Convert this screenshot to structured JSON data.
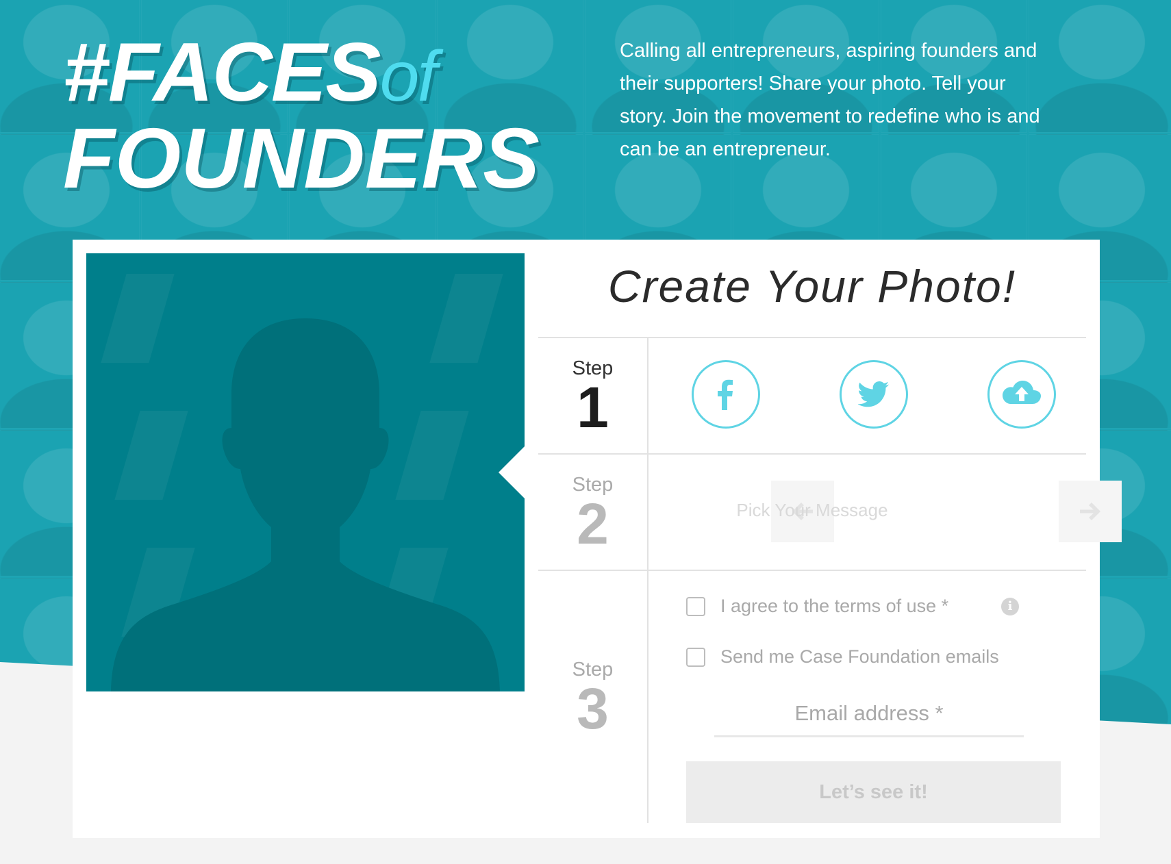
{
  "hero": {
    "title_hash": "#FACES",
    "title_of": "of",
    "title_line2": "FOUNDERS",
    "description": "Calling all entrepreneurs, aspiring founders and their supporters! Share your photo. Tell your story. Join the movement to redefine who is and can be an entrepreneur."
  },
  "panel": {
    "title": "Create Your Photo!",
    "steps": [
      {
        "word": "Step",
        "number": "1"
      },
      {
        "word": "Step",
        "number": "2"
      },
      {
        "word": "Step",
        "number": "3"
      }
    ],
    "step1": {
      "sources": [
        "facebook-icon",
        "twitter-icon",
        "cloud-upload-icon"
      ]
    },
    "step2": {
      "message_label": "Pick Your Message",
      "prev_icon": "arrow-left-icon",
      "next_icon": "arrow-right-icon"
    },
    "step3": {
      "terms_label": "I agree to the terms of use *",
      "emails_label": "Send me Case Foundation emails",
      "email_placeholder": "Email address *",
      "submit_label": "Let’s see it!"
    }
  },
  "colors": {
    "hero_bg": "#1ba3b2",
    "accent": "#4fdcef",
    "photo_bg": "#007f8b",
    "circle_border": "#5fd4e4"
  }
}
